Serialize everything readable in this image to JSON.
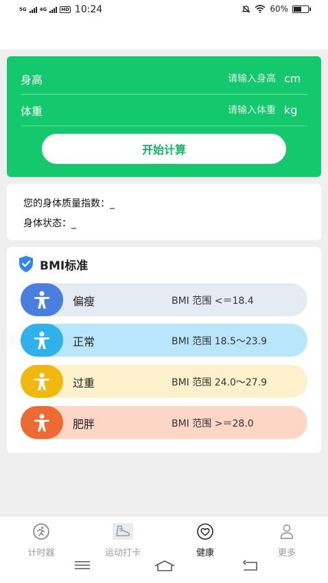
{
  "status_bar": {
    "signal1": "5G",
    "signal2": "4G",
    "hd": "HD",
    "time": "10:24",
    "battery": "60%",
    "battery_level": 0.6
  },
  "form": {
    "height_label": "身高",
    "height_placeholder": "请输入身高",
    "height_unit": "cm",
    "weight_label": "体重",
    "weight_placeholder": "请输入体重",
    "weight_unit": "kg",
    "calc_button": "开始计算"
  },
  "result": {
    "bmi_label": "您的身体质量指数：",
    "bmi_value": "_",
    "status_label": "身体状态：",
    "status_value": "_"
  },
  "bmi_standard": {
    "title": "BMI标准",
    "items": [
      {
        "name": "偏瘦",
        "range": "BMI 范围 <＝18.4",
        "color": "#4a7fe0"
      },
      {
        "name": "正常",
        "range": "BMI 范围 18.5～23.9",
        "color": "#2fb1ec"
      },
      {
        "name": "过重",
        "range": "BMI 范围 24.0～27.9",
        "color": "#f1b80f"
      },
      {
        "name": "肥胖",
        "range": "BMI 范围 >＝28.0",
        "color": "#ee6a33"
      }
    ]
  },
  "tabs": [
    {
      "label": "计时器",
      "icon": "runner-icon"
    },
    {
      "label": "运动打卡",
      "icon": "shoe-icon"
    },
    {
      "label": "健康",
      "icon": "heart-icon",
      "active": true
    },
    {
      "label": "更多",
      "icon": "person-icon"
    }
  ],
  "colors": {
    "accent_green": "#14c86e"
  }
}
